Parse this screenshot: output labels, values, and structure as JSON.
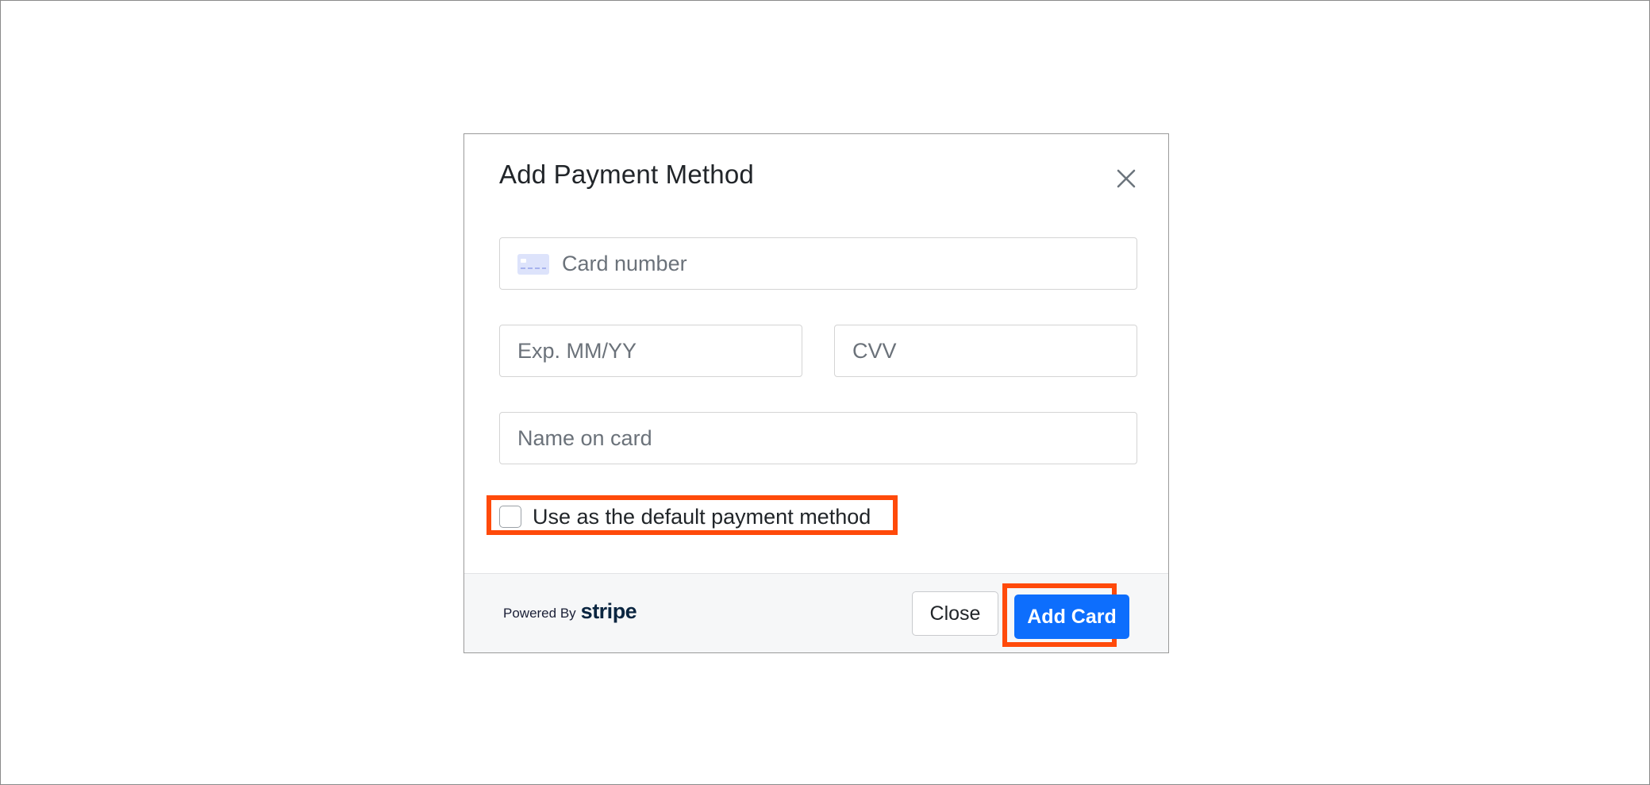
{
  "modal": {
    "title": "Add Payment Method",
    "close_icon": "close-icon"
  },
  "form": {
    "card_number": {
      "placeholder": "Card number",
      "value": "",
      "icon": "credit-card-icon"
    },
    "expiry": {
      "placeholder": "Exp. MM/YY",
      "value": ""
    },
    "cvv": {
      "placeholder": "CVV",
      "value": ""
    },
    "name_on_card": {
      "placeholder": "Name on card",
      "value": ""
    },
    "default_checkbox": {
      "label": "Use as the default payment method",
      "checked": false
    }
  },
  "footer": {
    "powered_by": "Powered By",
    "brand": "stripe",
    "close_label": "Close",
    "add_card_label": "Add Card"
  },
  "colors": {
    "primary": "#0d6efd",
    "highlight": "#ff4a0a",
    "footer_bg": "#f6f7f8",
    "stripe_brand": "#0a2540"
  }
}
